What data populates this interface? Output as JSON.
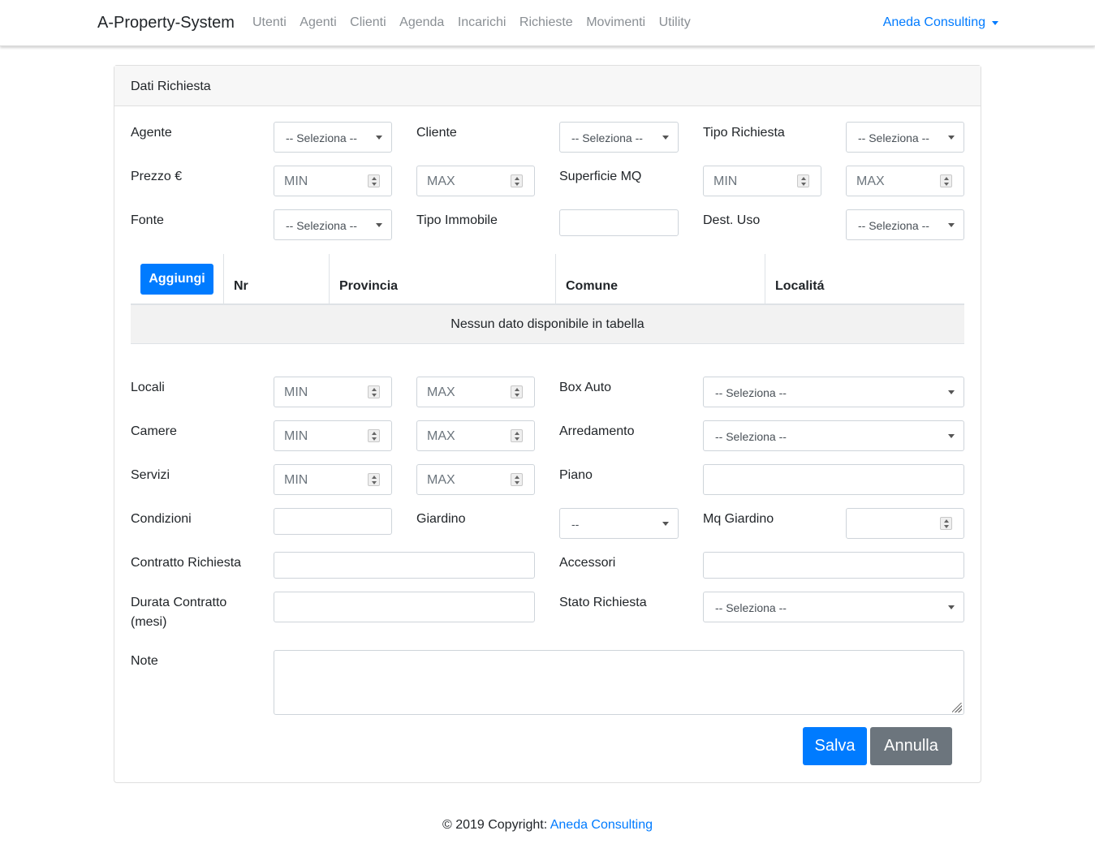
{
  "navbar": {
    "brand": "A-Property-System",
    "links": [
      "Utenti",
      "Agenti",
      "Clienti",
      "Agenda",
      "Incarichi",
      "Richieste",
      "Movimenti",
      "Utility"
    ],
    "user": "Aneda Consulting"
  },
  "card": {
    "title": "Dati Richiesta",
    "labels": {
      "agente": "Agente",
      "cliente": "Cliente",
      "tipo_richiesta": "Tipo Richiesta",
      "prezzo": "Prezzo €",
      "superficie": "Superficie MQ",
      "fonte": "Fonte",
      "tipo_immobile": "Tipo Immobile",
      "dest_uso": "Dest. Uso",
      "locali": "Locali",
      "box_auto": "Box Auto",
      "camere": "Camere",
      "arredamento": "Arredamento",
      "servizi": "Servizi",
      "piano": "Piano",
      "condizioni": "Condizioni",
      "giardino": "Giardino",
      "mq_giardino": "Mq Giardino",
      "contratto_richiesta": "Contratto Richiesta",
      "accessori": "Accessori",
      "durata_contratto_1": "Durata Contratto",
      "durata_contratto_2": "(mesi)",
      "stato_richiesta": "Stato Richiesta",
      "note": "Note"
    },
    "select_default": "-- Seleziona --",
    "giardino_default": "--",
    "min_placeholder": "MIN",
    "max_placeholder": "MAX"
  },
  "table": {
    "add_label": "Aggiungi",
    "headers": [
      "Nr",
      "Provincia",
      "Comune",
      "Localitá"
    ],
    "empty_text": "Nessun dato disponibile in tabella"
  },
  "actions": {
    "save": "Salva",
    "cancel": "Annulla"
  },
  "footer": {
    "text": "© 2019 Copyright:",
    "link": "Aneda Consulting"
  },
  "colors": {
    "primary": "#007bff",
    "secondary": "#6c757d"
  }
}
